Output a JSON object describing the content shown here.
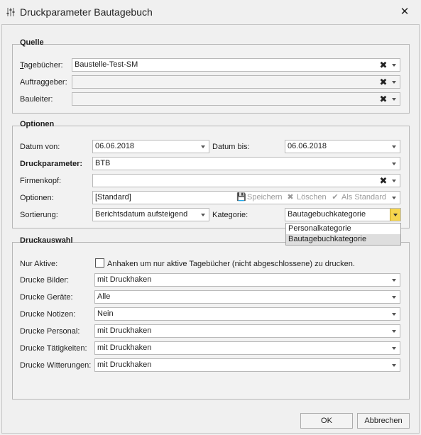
{
  "window": {
    "title": "Druckparameter Bautagebuch"
  },
  "quelle": {
    "title": "Quelle",
    "tagebuecher": {
      "label": "Tagebücher:",
      "value": "Baustelle-Test-SM"
    },
    "auftraggeber": {
      "label": "Auftraggeber:",
      "value": ""
    },
    "bauleiter": {
      "label": "Bauleiter:",
      "value": ""
    }
  },
  "optionen": {
    "title": "Optionen",
    "datum_von": {
      "label": "Datum von:",
      "value": "06.06.2018"
    },
    "datum_bis": {
      "label": "Datum bis:",
      "value": "06.06.2018"
    },
    "druckparameter": {
      "label": "Druckparameter:",
      "value": "BTB"
    },
    "firmenkopf": {
      "label": "Firmenkopf:",
      "value": ""
    },
    "optionen": {
      "label": "Optionen:",
      "value": "[Standard]",
      "speichern": "Speichern",
      "loeschen": "Löschen",
      "als_standard": "Als Standard"
    },
    "sortierung": {
      "label": "Sortierung:",
      "value": "Berichtsdatum aufsteigend"
    },
    "kategorie": {
      "label": "Kategorie:",
      "value": "Bautagebuchkategorie",
      "options": [
        "Personalkategorie",
        "Bautagebuchkategorie"
      ]
    }
  },
  "druckauswahl": {
    "title": "Druckauswahl",
    "nur_aktive": {
      "label": "Nur Aktive:",
      "checkbox_text": "Anhaken um nur aktive Tagebücher (nicht abgeschlossene) zu drucken.",
      "checked": false
    },
    "rows": [
      {
        "label": "Drucke Bilder:",
        "value": "mit Druckhaken"
      },
      {
        "label": "Drucke Geräte:",
        "value": "Alle"
      },
      {
        "label": "Drucke Notizen:",
        "value": "Nein"
      },
      {
        "label": "Drucke Personal:",
        "value": "mit Druckhaken"
      },
      {
        "label": "Drucke Tätigkeiten:",
        "value": "mit Druckhaken"
      },
      {
        "label": "Drucke Witterungen:",
        "value": "mit Druckhaken"
      }
    ]
  },
  "buttons": {
    "ok": "OK",
    "abbrechen": "Abbrechen"
  }
}
